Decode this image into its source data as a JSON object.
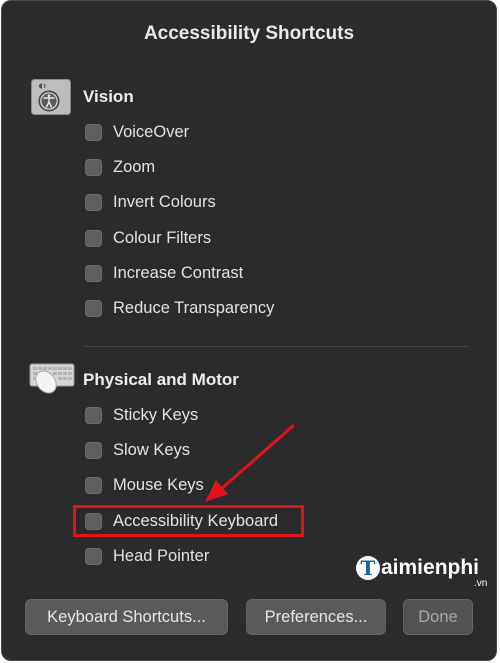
{
  "dialog": {
    "title": "Accessibility Shortcuts"
  },
  "sections": {
    "vision": {
      "title": "Vision",
      "icon": "accessibility-person-icon",
      "items": [
        {
          "label": "VoiceOver",
          "checked": false
        },
        {
          "label": "Zoom",
          "checked": false
        },
        {
          "label": "Invert Colours",
          "checked": false
        },
        {
          "label": "Colour Filters",
          "checked": false
        },
        {
          "label": "Increase Contrast",
          "checked": false
        },
        {
          "label": "Reduce Transparency",
          "checked": false
        }
      ]
    },
    "motor": {
      "title": "Physical and Motor",
      "icon": "keyboard-mouse-icon",
      "items": [
        {
          "label": "Sticky Keys",
          "checked": false
        },
        {
          "label": "Slow Keys",
          "checked": false
        },
        {
          "label": "Mouse Keys",
          "checked": false
        },
        {
          "label": "Accessibility Keyboard",
          "checked": false
        },
        {
          "label": "Head Pointer",
          "checked": false
        }
      ]
    }
  },
  "buttons": {
    "keyboard_shortcuts": "Keyboard Shortcuts...",
    "preferences": "Preferences...",
    "done": "Done"
  },
  "annotation": {
    "color": "#e0141b",
    "target": "Accessibility Keyboard"
  },
  "watermark": {
    "logo_letter": "T",
    "text": "aimienphi",
    "suffix": ".vn"
  }
}
